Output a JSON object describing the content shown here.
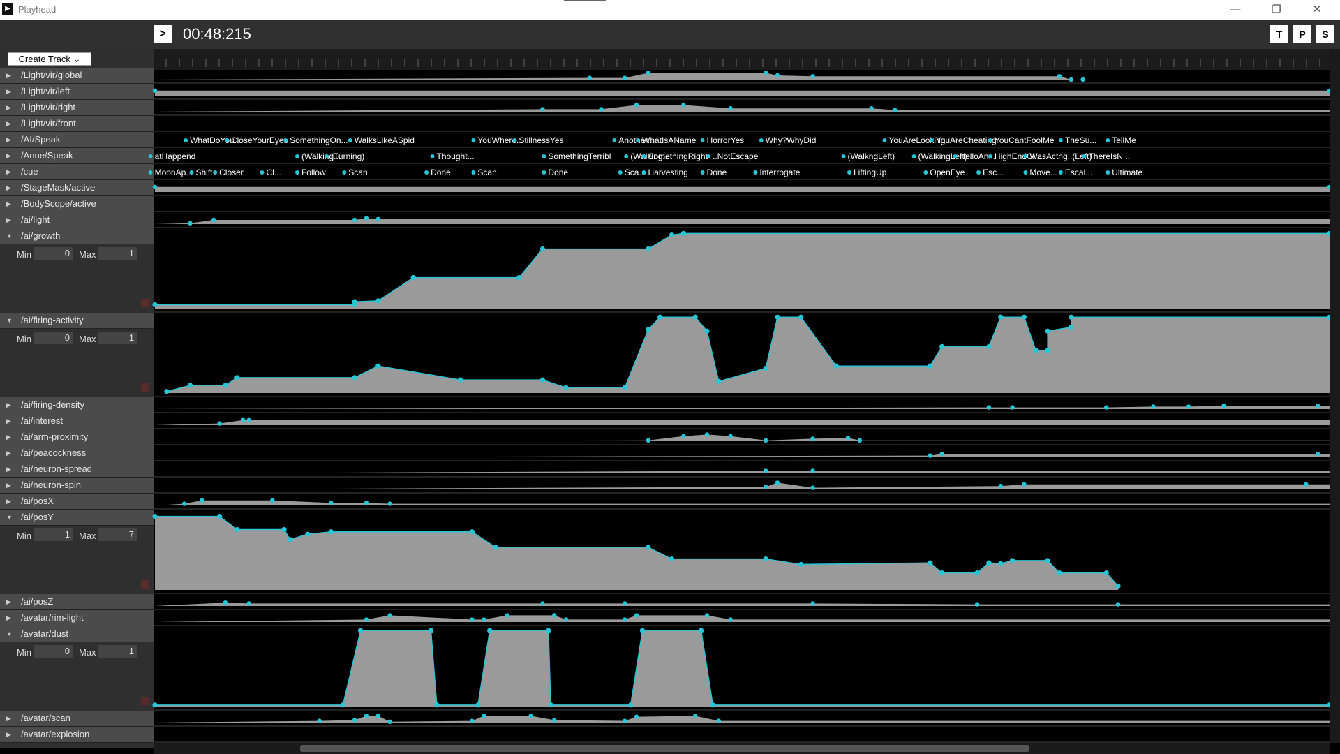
{
  "window": {
    "title": "Playhead",
    "minimize": "—",
    "restore": "❐",
    "close": "✕"
  },
  "toolbar": {
    "play_label": ">",
    "time": "00:48:215",
    "btn_t": "T",
    "btn_p": "P",
    "btn_s": "S"
  },
  "create_track": {
    "label": "Create Track",
    "arrow": "⌄"
  },
  "tracks": [
    {
      "name": "/Light/vir/global",
      "expanded": false
    },
    {
      "name": "/Light/vir/left",
      "expanded": false
    },
    {
      "name": "/Light/vir/right",
      "expanded": false
    },
    {
      "name": "/Light/vir/front",
      "expanded": false
    },
    {
      "name": "/AI/Speak",
      "expanded": false
    },
    {
      "name": "/Anne/Speak",
      "expanded": false
    },
    {
      "name": "/cue",
      "expanded": false
    },
    {
      "name": "/StageMask/active",
      "expanded": false
    },
    {
      "name": "/BodyScope/active",
      "expanded": false
    },
    {
      "name": "/ai/light",
      "expanded": false
    },
    {
      "name": "/ai/growth",
      "expanded": true,
      "min": "0",
      "max": "1"
    },
    {
      "name": "/ai/firing-activity",
      "expanded": true,
      "min": "0",
      "max": "1"
    },
    {
      "name": "/ai/firing-density",
      "expanded": false
    },
    {
      "name": "/ai/interest",
      "expanded": false
    },
    {
      "name": "/ai/arm-proximity",
      "expanded": false
    },
    {
      "name": "/ai/peacockness",
      "expanded": false
    },
    {
      "name": "/ai/neuron-spread",
      "expanded": false
    },
    {
      "name": "/ai/neuron-spin",
      "expanded": false
    },
    {
      "name": "/ai/posX",
      "expanded": false
    },
    {
      "name": "/ai/posY",
      "expanded": true,
      "min": "1",
      "max": "7"
    },
    {
      "name": "/ai/posZ",
      "expanded": false
    },
    {
      "name": "/avatar/rim-light",
      "expanded": false
    },
    {
      "name": "/avatar/dust",
      "expanded": true,
      "min": "0",
      "max": "1"
    },
    {
      "name": "/avatar/scan",
      "expanded": false
    },
    {
      "name": "/avatar/explosion",
      "expanded": false
    }
  ],
  "labels": {
    "min": "Min",
    "max": "Max"
  },
  "ai_speak_cues": [
    "WhatDoYou...",
    "CloseYourEyes",
    "SomethingOn...",
    "WalksLikeASpid",
    "YouWhere...",
    "StillnessYes",
    "Another...",
    "WhatIsAName",
    "HorrorYes",
    "Why?WhyDid",
    "YouAreLooking",
    "YouAreCheating",
    "YouCantFoolMe",
    "TheSu...",
    "TellMe"
  ],
  "anne_speak_cues": [
    "atHappend",
    "(Walking...",
    "(Turning)",
    "Thought...",
    "SomethingTerribl",
    "(Walking...",
    "SomethingRight",
    "..NotEscape",
    "(WalkngLeft)",
    "(WalkingLeft)",
    "HelloAn...",
    "HighEndCl...",
    "WasActng..(Left)",
    "ThereIsN..."
  ],
  "cue_cues": [
    "MoonAp...",
    "Shift",
    "Closer",
    "Cl...",
    "Follow",
    "Scan",
    "Done",
    "Scan",
    "Done",
    "Sca...",
    "Harvesting",
    "Done",
    "Interrogate",
    "LiftingUp",
    "OpenEye",
    "Esc...",
    "Move...",
    "Escal...",
    "Ultimate"
  ],
  "colors": {
    "curve": "#26c6d6",
    "fill": "#9a9a9a",
    "row_bg": "#000000",
    "label_bg": "#4b4b4b",
    "cue_marker": "#26c6d6"
  }
}
